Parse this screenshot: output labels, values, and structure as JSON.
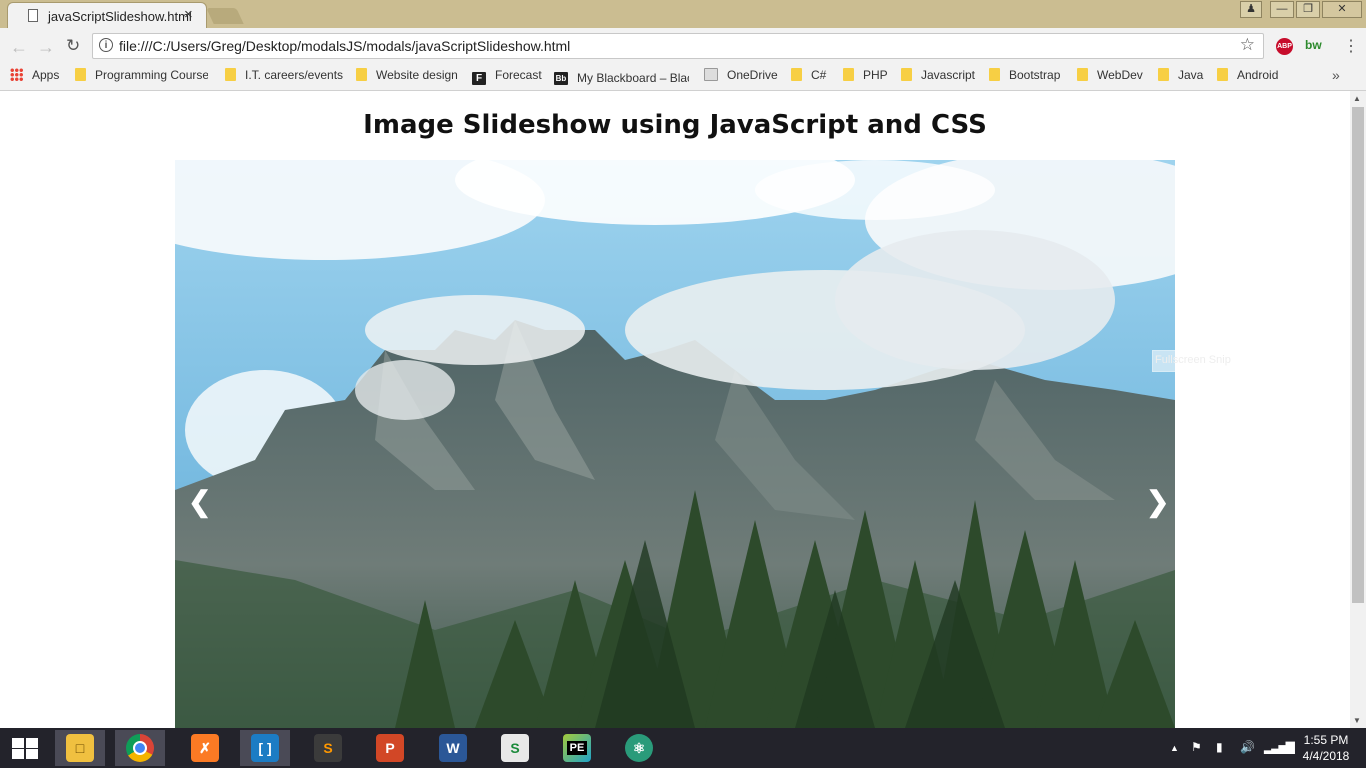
{
  "browser": {
    "tab_title": "javaScriptSlideshow.html",
    "tab_close": "×",
    "url": "file:///C:/Users/Greg/Desktop/modalsJS/modals/javaScriptSlideshow.html",
    "extensions": {
      "abp": "ABP",
      "bw": "bw"
    },
    "bookmarks": [
      {
        "label": "Apps",
        "icon": "apps-grid-icon"
      },
      {
        "label": "Programming Course",
        "icon": "folder-icon"
      },
      {
        "label": "I.T. careers/events",
        "icon": "folder-icon"
      },
      {
        "label": "Website design",
        "icon": "folder-icon"
      },
      {
        "label": "Forecast",
        "icon": "forecast-icon"
      },
      {
        "label": "My Blackboard – Blac",
        "icon": "blackboard-icon"
      },
      {
        "label": "OneDrive",
        "icon": "onedrive-icon"
      },
      {
        "label": "C#",
        "icon": "folder-icon"
      },
      {
        "label": "PHP",
        "icon": "folder-icon"
      },
      {
        "label": "Javascript",
        "icon": "folder-icon"
      },
      {
        "label": "Bootstrap",
        "icon": "folder-icon"
      },
      {
        "label": "WebDev",
        "icon": "folder-icon"
      },
      {
        "label": "Java",
        "icon": "folder-icon"
      },
      {
        "label": "Android",
        "icon": "folder-icon"
      }
    ],
    "bookmarks_overflow": "»"
  },
  "page": {
    "heading": "Image Slideshow using JavaScript and CSS",
    "prev_label": "❮",
    "next_label": "❯",
    "overlay_text": "Fullscreen Snip"
  },
  "taskbar": {
    "apps": [
      {
        "name": "File Explorer",
        "icon": "file-explorer-icon",
        "active": true
      },
      {
        "name": "Google Chrome",
        "icon": "chrome-icon",
        "active": true
      },
      {
        "name": "XAMPP",
        "icon": "xampp-icon",
        "active": false
      },
      {
        "name": "Brackets",
        "icon": "brackets-icon",
        "active": true
      },
      {
        "name": "Sublime Text",
        "icon": "sublime-icon",
        "active": false
      },
      {
        "name": "PowerPoint",
        "icon": "powerpoint-icon",
        "active": false
      },
      {
        "name": "Word",
        "icon": "word-icon",
        "active": false
      },
      {
        "name": "Snagit",
        "icon": "snagit-icon",
        "active": false
      },
      {
        "name": "PhpStorm",
        "icon": "phpstorm-icon",
        "active": false
      },
      {
        "name": "Atom",
        "icon": "atom-icon",
        "active": false
      }
    ],
    "time": "1:55 PM",
    "date": "4/4/2018"
  },
  "colors": {
    "titlebar": "#cbbd91",
    "toolbar": "#f2f2f2",
    "taskbar": "#23232b",
    "sky": "#6fb4dc",
    "forest": "#2e4a2a"
  }
}
